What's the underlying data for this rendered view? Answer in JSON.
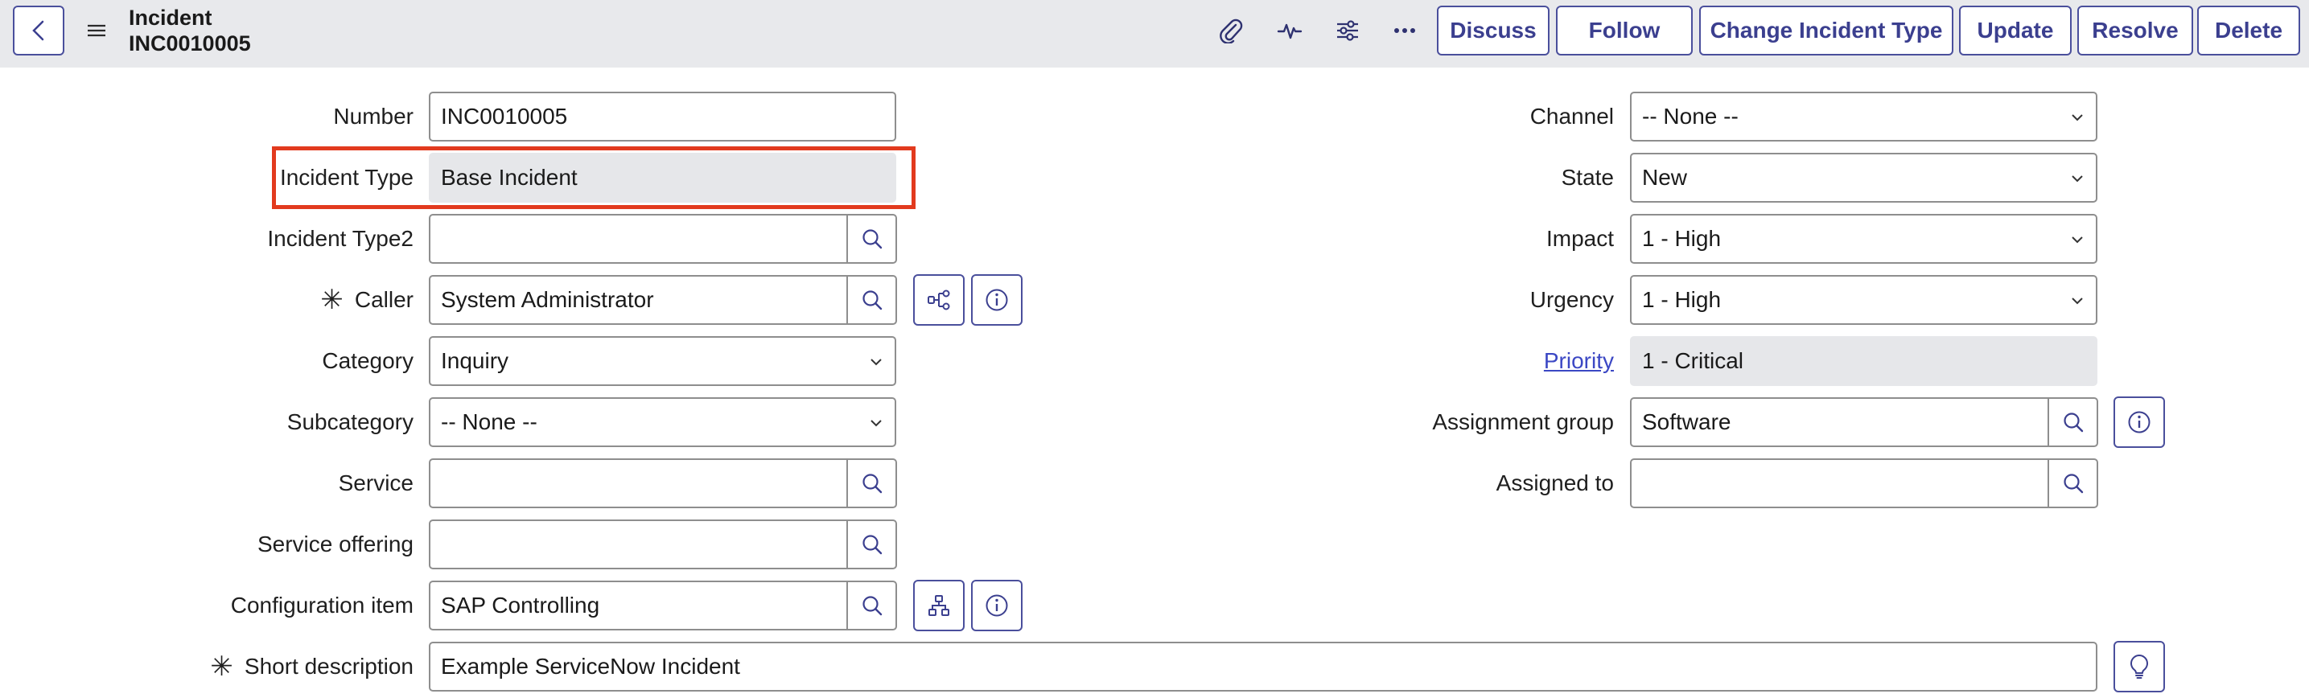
{
  "header": {
    "title": "Incident",
    "number": "INC0010005",
    "buttons": {
      "discuss": "Discuss",
      "follow": "Follow",
      "change_type": "Change Incident Type",
      "update": "Update",
      "resolve": "Resolve",
      "delete": "Delete"
    },
    "icons": [
      "back-icon",
      "menu-icon",
      "paperclip-icon",
      "activity-icon",
      "settings-sliders-icon",
      "more-icon"
    ]
  },
  "form": {
    "left": {
      "number": {
        "label": "Number",
        "value": "INC0010005"
      },
      "incident_type": {
        "label": "Incident Type",
        "value": "Base Incident"
      },
      "incident_type2": {
        "label": "Incident Type2",
        "value": ""
      },
      "caller": {
        "label": "Caller",
        "value": "System Administrator",
        "required": "✳"
      },
      "category": {
        "label": "Category",
        "value": "Inquiry"
      },
      "subcategory": {
        "label": "Subcategory",
        "value": "-- None --"
      },
      "service": {
        "label": "Service",
        "value": ""
      },
      "service_offering": {
        "label": "Service offering",
        "value": ""
      },
      "configuration_item": {
        "label": "Configuration item",
        "value": "SAP Controlling"
      }
    },
    "right": {
      "channel": {
        "label": "Channel",
        "value": "-- None --"
      },
      "state": {
        "label": "State",
        "value": "New"
      },
      "impact": {
        "label": "Impact",
        "value": "1 - High"
      },
      "urgency": {
        "label": "Urgency",
        "value": "1 - High"
      },
      "priority": {
        "label": "Priority",
        "value": "1 - Critical"
      },
      "assignment_group": {
        "label": "Assignment group",
        "value": "Software"
      },
      "assigned_to": {
        "label": "Assigned to",
        "value": ""
      }
    },
    "short_description": {
      "label": "Short description",
      "value": "Example ServiceNow Incident",
      "required": "✳"
    }
  },
  "colors": {
    "accent": "#4a4f9c",
    "highlight": "#e23a1e",
    "readonly_bg": "#e6e7ea",
    "link": "#3b47c4"
  }
}
